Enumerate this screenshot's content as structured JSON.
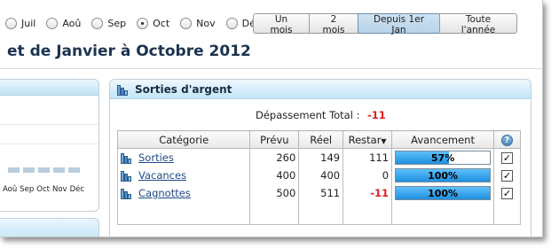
{
  "months": [
    {
      "label": "Juil",
      "checked": false
    },
    {
      "label": "Aoû",
      "checked": false
    },
    {
      "label": "Sep",
      "checked": false
    },
    {
      "label": "Oct",
      "checked": true
    },
    {
      "label": "Nov",
      "checked": false
    },
    {
      "label": "Déc",
      "checked": false
    }
  ],
  "range_buttons": [
    {
      "label": "Un mois",
      "active": false
    },
    {
      "label": "2 mois",
      "active": false
    },
    {
      "label": "Depuis 1er Jan",
      "active": true
    },
    {
      "label": "Toute l'année",
      "active": false
    }
  ],
  "page_title": "et de Janvier à Octobre 2012",
  "left_panel": {
    "axis_labels": [
      "Aoû",
      "Sep",
      "Oct",
      "Nov",
      "Déc"
    ]
  },
  "panel": {
    "title": "Sorties d'argent",
    "icon": "books-icon",
    "overrun_label": "Dépassement Total :",
    "overrun_value": "-11",
    "columns": {
      "category": "Catégorie",
      "planned": "Prévu",
      "actual": "Réel",
      "remaining": "Restar",
      "remaining_sort": "▼",
      "progress": "Avancement",
      "help": "?"
    },
    "rows": [
      {
        "category": "Sorties",
        "planned": "260",
        "actual": "149",
        "remaining": "111",
        "negative": false,
        "progress_label": "57%",
        "progress": 0.57,
        "checked": "✓"
      },
      {
        "category": "Vacances",
        "planned": "400",
        "actual": "400",
        "remaining": "0",
        "negative": false,
        "progress_label": "100%",
        "progress": 1.0,
        "checked": "✓"
      },
      {
        "category": "Cagnottes",
        "planned": "500",
        "actual": "511",
        "remaining": "-11",
        "negative": true,
        "progress_label": "100%",
        "progress": 1.0,
        "checked": "✓"
      }
    ]
  },
  "colors": {
    "accent": "#1f8fde",
    "negative": "#e11d1d",
    "title": "#1b3350",
    "header_gradient_end": "#c3e5f7"
  }
}
